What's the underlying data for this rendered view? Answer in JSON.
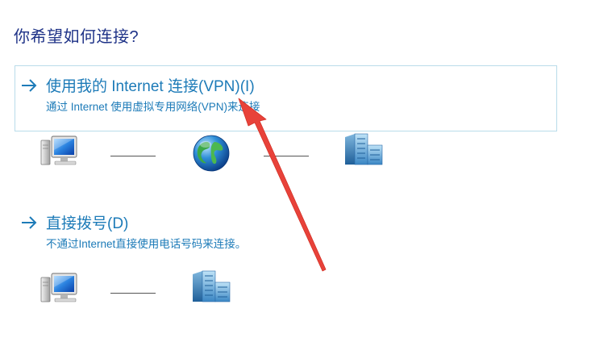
{
  "heading": "你希望如何连接?",
  "options": [
    {
      "title": "使用我的 Internet 连接(VPN)(I)",
      "description": "通过 Internet 使用虚拟专用网络(VPN)来连接",
      "diagram": [
        "computer-icon",
        "globe-icon",
        "server-icon"
      ]
    },
    {
      "title": "直接拨号(D)",
      "description": "不通过Internet直接使用电话号码来连接。",
      "diagram": [
        "computer-icon",
        "server-icon"
      ]
    }
  ],
  "colors": {
    "heading": "#1e3287",
    "link": "#1d7bb8",
    "selection_border": "#b9dcea",
    "annotation_arrow": "#e8423a"
  }
}
